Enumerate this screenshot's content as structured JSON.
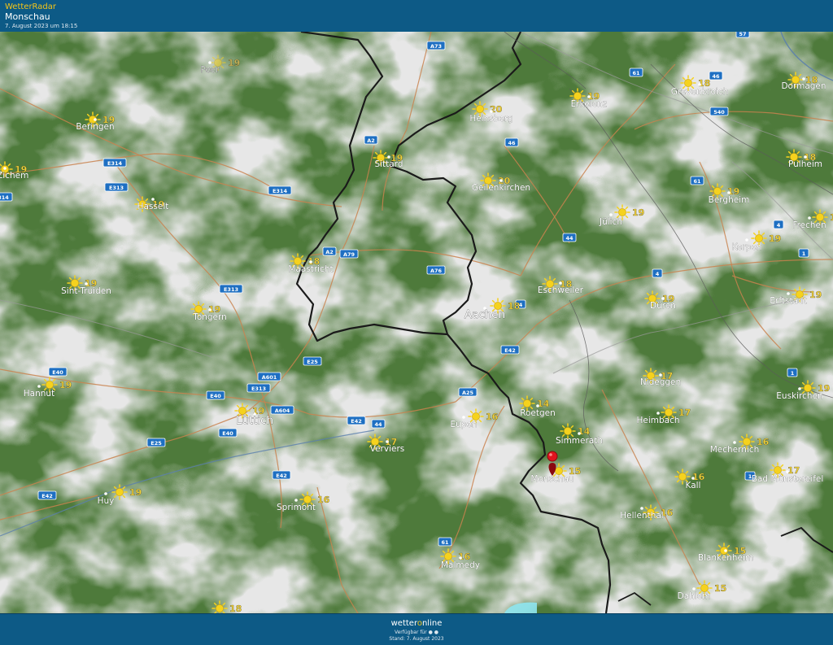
{
  "header": {
    "brand": "WetterRadar",
    "location": "Monschau",
    "timestamp": "7. August 2023 um 18:15"
  },
  "footer": {
    "logo_pre": "wetter",
    "logo_o": "o",
    "logo_post": "nline",
    "availability": "Verfügbar für",
    "stand": "Stand: 7. August 2023"
  },
  "colors": {
    "forest": "#4f7a3c",
    "cloud": "#cfcfcf",
    "border": "#1a1a1a",
    "road": "#c9824f",
    "road_shield": "#1e6fc2",
    "label": "#ffffff",
    "temp": "#f3d23a",
    "sun": "#f5d21e",
    "marker": "#e0141e"
  },
  "marker": {
    "name": "Monschau",
    "icon": "location-pin-icon"
  },
  "cities": [
    {
      "name": "Peer",
      "temp": "19",
      "dim": true
    },
    {
      "name": "Beringen",
      "temp": "19"
    },
    {
      "name": "Hasselt",
      "temp": "19"
    },
    {
      "name": "vel-Zichem",
      "temp": "19"
    },
    {
      "name": "Sint-Truiden",
      "temp": "19"
    },
    {
      "name": "Tongern",
      "temp": "19"
    },
    {
      "name": "Hannut",
      "temp": "19"
    },
    {
      "name": "Lüttich",
      "temp": "19",
      "big": true
    },
    {
      "name": "Huy",
      "temp": "19"
    },
    {
      "name": "Sprimont",
      "temp": "16"
    },
    {
      "name": "Verviers",
      "temp": "17"
    },
    {
      "name": "Maastricht",
      "temp": "18"
    },
    {
      "name": "Sittard",
      "temp": "19"
    },
    {
      "name": "Heinsberg",
      "temp": "20"
    },
    {
      "name": "Geilenkirchen",
      "temp": "20"
    },
    {
      "name": "Erkelenz",
      "temp": "19"
    },
    {
      "name": "Grevenbroich",
      "temp": "18"
    },
    {
      "name": "Dormagen",
      "temp": "18"
    },
    {
      "name": "Pulheim",
      "temp": "18"
    },
    {
      "name": "Bergheim",
      "temp": "19"
    },
    {
      "name": "Jülich",
      "temp": "19"
    },
    {
      "name": "Frechen",
      "temp": "18"
    },
    {
      "name": "Kerpen",
      "temp": "19"
    },
    {
      "name": "Eschweiler",
      "temp": "18"
    },
    {
      "name": "Aachen",
      "temp": "18",
      "big": true
    },
    {
      "name": "Düren",
      "temp": "19"
    },
    {
      "name": "Erftstadt",
      "temp": "19"
    },
    {
      "name": "Eupen",
      "temp": "16"
    },
    {
      "name": "Roetgen",
      "temp": "14"
    },
    {
      "name": "Simmerath",
      "temp": "14"
    },
    {
      "name": "Monschau",
      "temp": "15"
    },
    {
      "name": "Nideggen",
      "temp": "17"
    },
    {
      "name": "Heimbach",
      "temp": "17"
    },
    {
      "name": "Euskirchen",
      "temp": "19"
    },
    {
      "name": "Mechernich",
      "temp": "16"
    },
    {
      "name": "Kall",
      "temp": "16"
    },
    {
      "name": "Bad Münstereifel",
      "temp": "17"
    },
    {
      "name": "Hellenthal",
      "temp": "16"
    },
    {
      "name": "Blankenheim",
      "temp": "15"
    },
    {
      "name": "Dahlem",
      "temp": "15"
    },
    {
      "name": "Malmedy",
      "temp": "16"
    },
    {
      "name": "",
      "temp": "18"
    }
  ],
  "roads": [
    "A73",
    "61",
    "46",
    "57",
    "A2",
    "E314",
    "E313",
    "E314",
    "46",
    "540",
    "61",
    "A2",
    "A79",
    "A76",
    "44",
    "4",
    "4",
    "E313",
    "4",
    "1",
    "E25",
    "A601",
    "E313",
    "E40",
    "E40",
    "A25",
    "A604",
    "E40",
    "E42",
    "44",
    "E42",
    "E25",
    "E42",
    "E42",
    "61",
    "1",
    "1",
    "314"
  ]
}
